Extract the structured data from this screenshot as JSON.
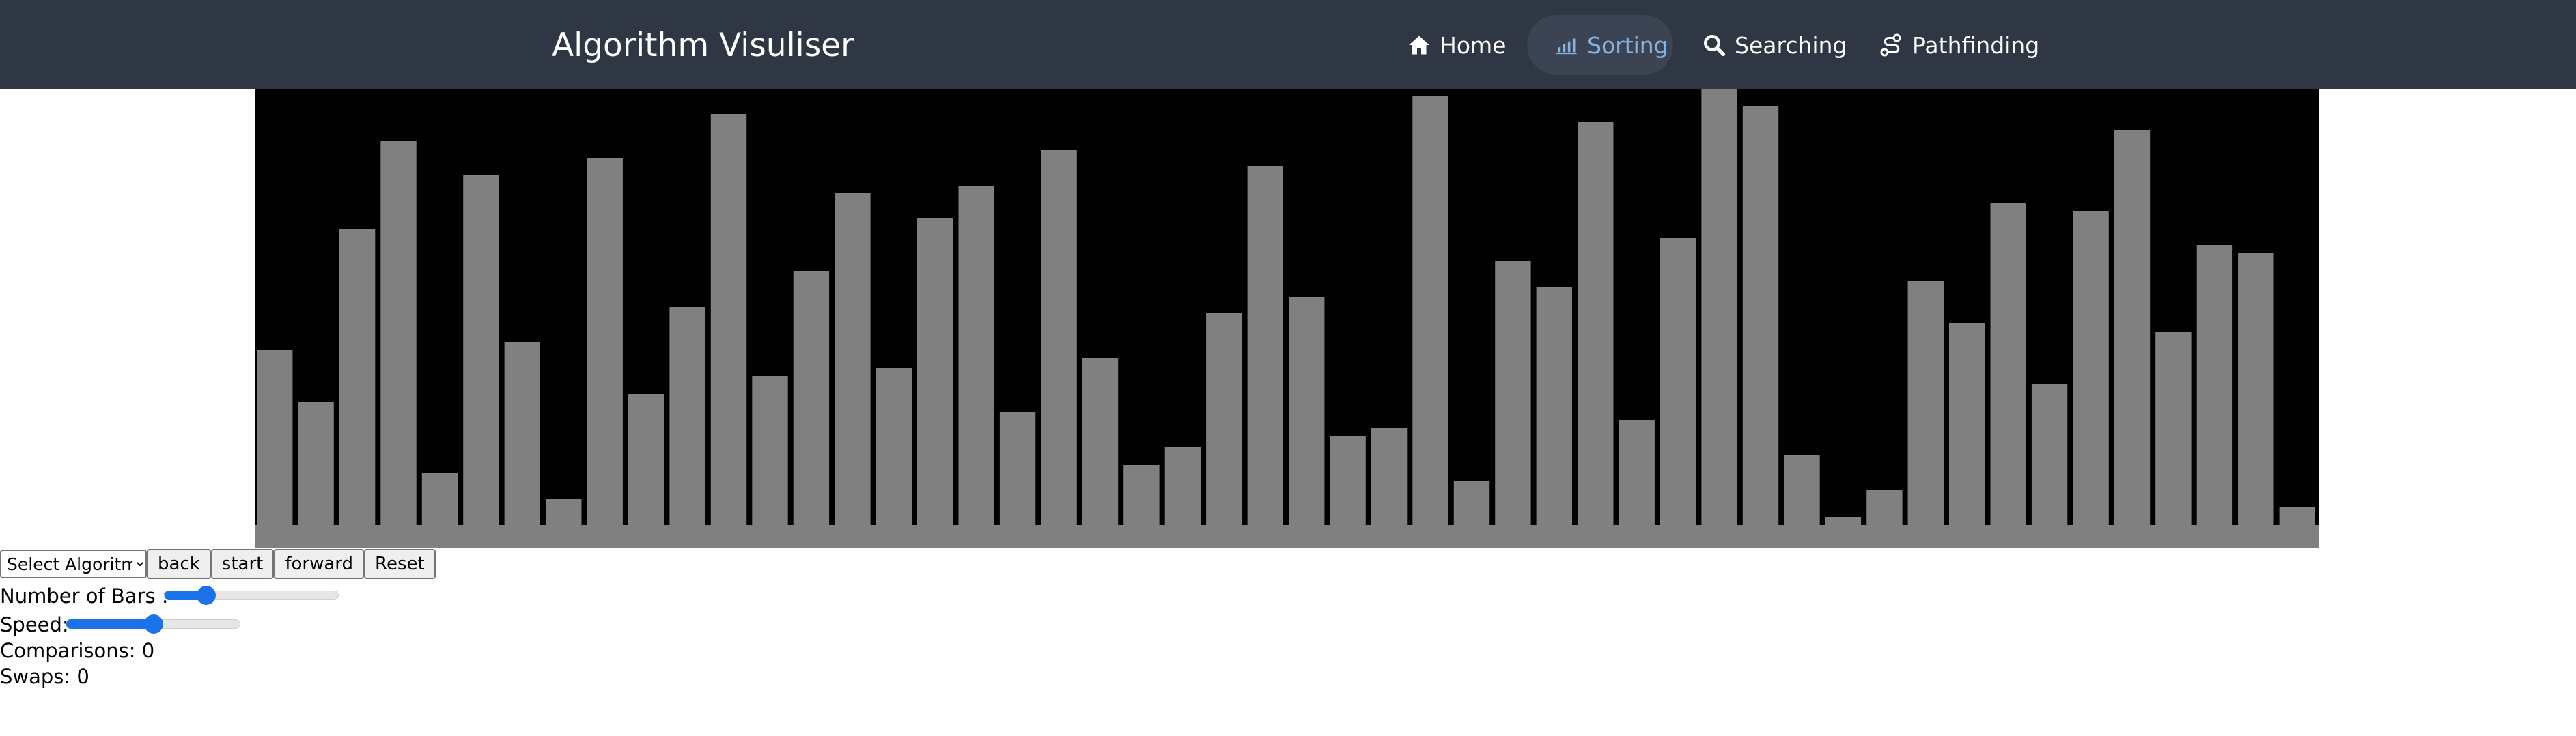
{
  "navbar": {
    "brand": "Algorithm Visuliser",
    "items": [
      {
        "label": "Home",
        "icon": "home-icon",
        "active": false
      },
      {
        "label": "Sorting",
        "icon": "bar-chart-icon",
        "active": true
      },
      {
        "label": "Searching",
        "icon": "search-icon",
        "active": false
      },
      {
        "label": "Pathfinding",
        "icon": "route-icon",
        "active": false
      }
    ],
    "colors": {
      "background": "#303744",
      "active_bg": "#3c4453",
      "active_text": "#84b4e2"
    }
  },
  "visualiser": {
    "bar_color": "#808080",
    "background": "#000000",
    "bar_values": [
      256,
      180,
      434,
      562,
      76,
      512,
      268,
      38,
      538,
      192,
      320,
      602,
      218,
      372,
      486,
      230,
      450,
      496,
      166,
      550,
      244,
      88,
      114,
      310,
      526,
      334,
      130,
      142,
      628,
      64,
      386,
      348,
      590,
      154,
      420,
      640,
      614,
      102,
      12,
      52,
      358,
      296,
      472,
      206,
      460,
      578,
      282,
      410,
      398,
      26
    ]
  },
  "controls": {
    "algorithm_select": {
      "value": "Select Algoritm",
      "options": [
        "Select Algoritm"
      ]
    },
    "back_label": "back",
    "start_label": "start",
    "forward_label": "forward",
    "reset_label": "Reset",
    "bars_label": "Number of Bars :",
    "bars_slider_value": 0.24,
    "speed_label": "Speed:",
    "speed_slider_value": 0.5,
    "comparisons_label": "Comparisons:",
    "comparisons_value": "0",
    "swaps_label": "Swaps:",
    "swaps_value": "0"
  }
}
